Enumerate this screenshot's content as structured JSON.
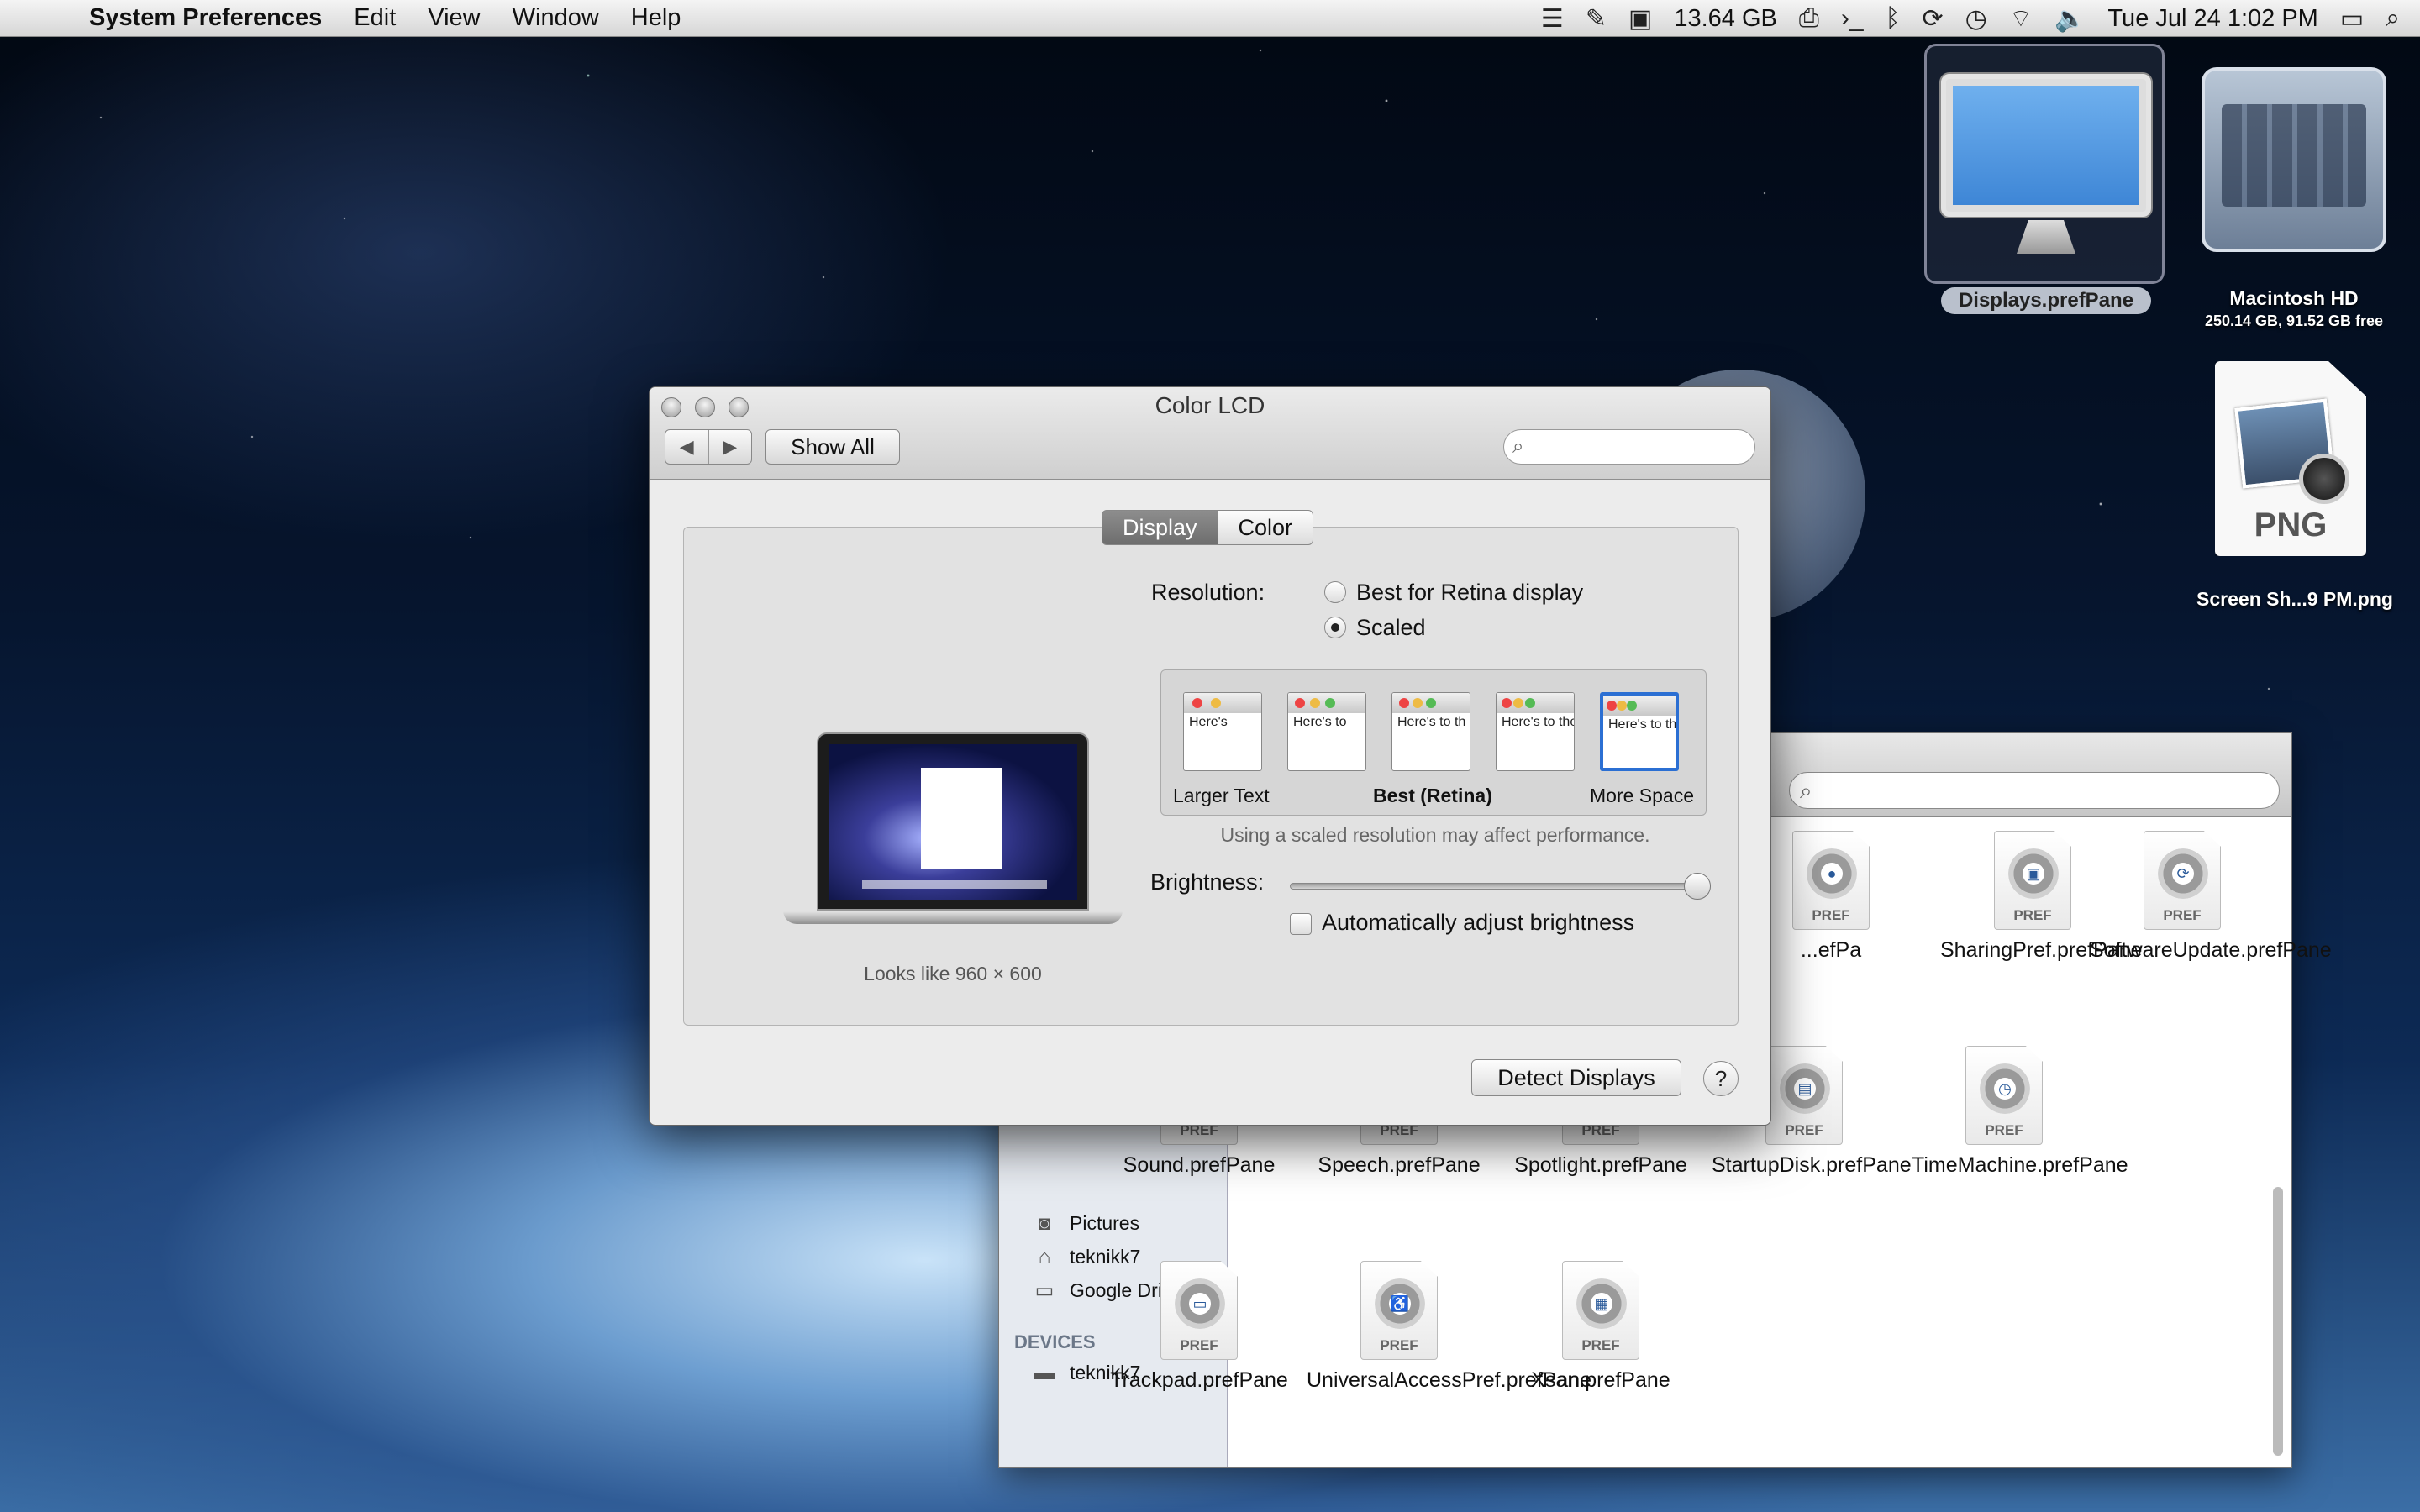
{
  "menubar": {
    "app_name": "System Preferences",
    "menus": [
      "Edit",
      "View",
      "Window",
      "Help"
    ],
    "memory": "13.64 GB",
    "datetime": "Tue Jul 24  1:02 PM"
  },
  "desktop": {
    "displays_icon_label": "Displays.prefPane",
    "hd_label": "Macintosh HD",
    "hd_sub": "250.14 GB, 91.52 GB free",
    "png_badge": "PNG",
    "png_label": "Screen Sh...9 PM.png"
  },
  "window": {
    "title": "Color LCD",
    "back": "◀",
    "forward": "▶",
    "show_all": "Show All",
    "search_placeholder": "",
    "tabs": [
      "Display",
      "Color"
    ],
    "looks_like": "Looks like 960 × 600",
    "resolution_label": "Resolution:",
    "radio_best": "Best for Retina display",
    "radio_scaled": "Scaled",
    "scale_options": {
      "larger": "Larger Text",
      "best": "Best (Retina)",
      "more": "More Space"
    },
    "thumb_texts": [
      "Here's",
      "Here's to",
      "Here's to th",
      "Here's to the cr",
      "Here's to the crazy ones"
    ],
    "note": "Using a scaled resolution may affect performance.",
    "brightness_label": "Brightness:",
    "brightness_value": 1.0,
    "auto_brightness": "Automatically adjust brightness",
    "detect": "Detect Displays",
    "help": "?"
  },
  "finder": {
    "sidebar": {
      "items": [
        "Pictures",
        "teknikk7",
        "Google Drive"
      ],
      "devices_heading": "DEVICES",
      "devices": [
        "teknikk7"
      ]
    },
    "pref_tag": "PREF",
    "row1": [
      {
        "name": "...efPa",
        "icon": "prefpane-icon"
      },
      {
        "name": "SharingPref.prefPane",
        "icon": "sharing-icon"
      },
      {
        "name": "SoftwareUpdate.prefPane",
        "icon": "software-update-icon"
      }
    ],
    "row2": [
      {
        "name": "Sound.prefPane"
      },
      {
        "name": "Speech.prefPane"
      },
      {
        "name": "Spotlight.prefPane"
      },
      {
        "name": "StartupDisk.prefPane"
      },
      {
        "name": "TimeMachine.prefPane"
      }
    ],
    "row3": [
      {
        "name": "Trackpad.prefPane"
      },
      {
        "name": "UniversalAccessPref.prefPane"
      },
      {
        "name": "Xsan.prefPane"
      }
    ]
  }
}
